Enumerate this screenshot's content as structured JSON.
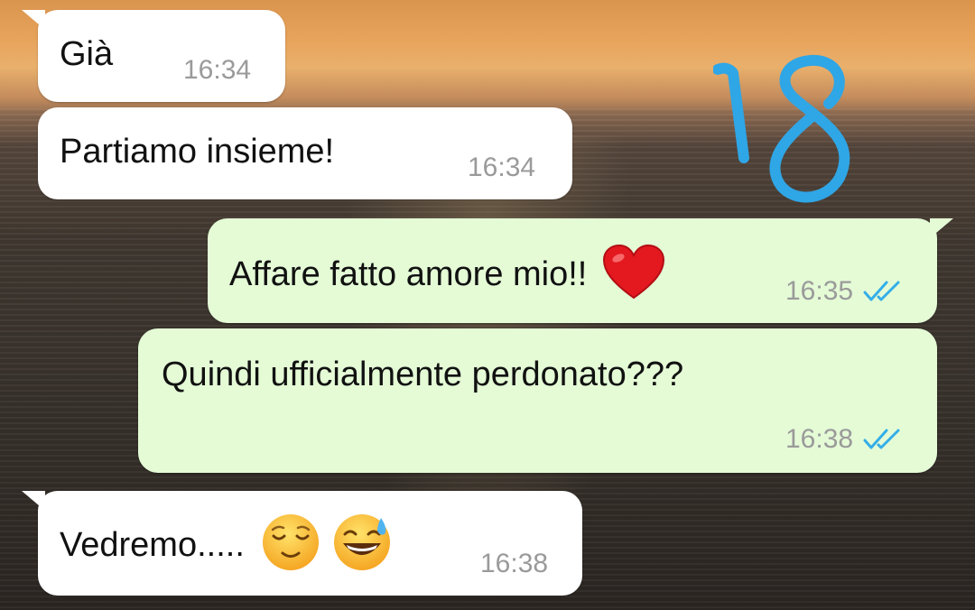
{
  "messages": [
    {
      "id": "m1",
      "direction": "incoming",
      "text": "Già",
      "time": "16:34"
    },
    {
      "id": "m2",
      "direction": "incoming",
      "text": "Partiamo insieme!",
      "time": "16:34"
    },
    {
      "id": "m3",
      "direction": "outgoing",
      "text": "Affare fatto amore mio!!",
      "emoji": [
        "red-heart"
      ],
      "time": "16:35",
      "status": "read"
    },
    {
      "id": "m4",
      "direction": "outgoing",
      "text": "Quindi ufficialmente perdonato???",
      "time": "16:38",
      "status": "read"
    },
    {
      "id": "m5",
      "direction": "incoming",
      "text": "Vedremo.....",
      "emoji": [
        "relieved-face",
        "grinning-face-with-sweat"
      ],
      "time": "16:38"
    }
  ],
  "overlay": {
    "text": "18",
    "color": "#2fa6e6"
  },
  "colors": {
    "incoming_bubble": "#ffffff",
    "outgoing_bubble": "#e4fbd6",
    "read_ticks": "#34aee8",
    "timestamp": "#9a9a9a"
  }
}
